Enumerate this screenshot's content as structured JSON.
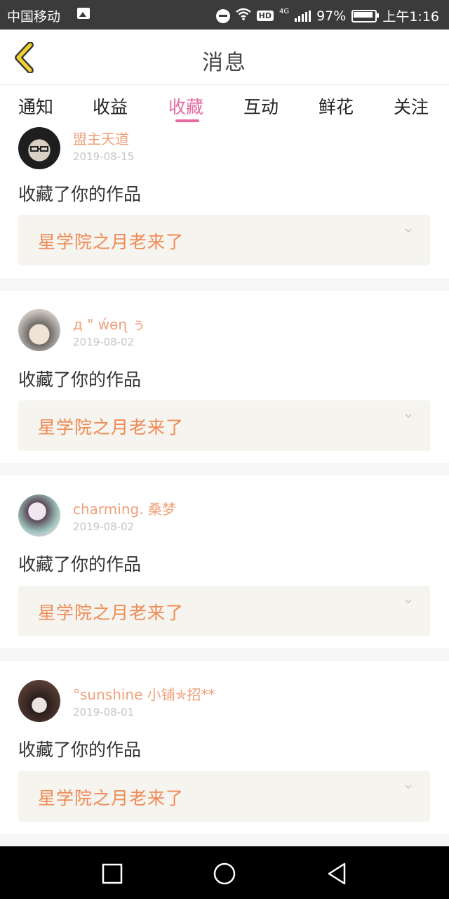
{
  "status_bar": {
    "carrier": "中国移动",
    "network_type": "4G",
    "hd_label": "HD",
    "battery": "97%",
    "time": "上午1:16",
    "icons": [
      "image-icon",
      "do-not-disturb-icon",
      "wifi-icon",
      "signal-icon",
      "battery-icon"
    ]
  },
  "header": {
    "title": "消息",
    "back_icon": "back-chevron-icon"
  },
  "tabs": [
    {
      "label": "通知",
      "active": false
    },
    {
      "label": "收益",
      "active": false
    },
    {
      "label": "收藏",
      "active": true
    },
    {
      "label": "互动",
      "active": false
    },
    {
      "label": "鲜花",
      "active": false
    },
    {
      "label": "关注",
      "active": false
    }
  ],
  "accent_color": "#e56ba1",
  "name_color": "#f0a07a",
  "work_title_color": "#f08a56",
  "notifications": [
    {
      "username": "盟主天道",
      "date": "2019-08-15",
      "action": "收藏了你的作品",
      "work_title": "星学院之月老来了"
    },
    {
      "username": "д \" ẃɵɳ ぅ",
      "date": "2019-08-02",
      "action": "收藏了你的作品",
      "work_title": "星学院之月老来了"
    },
    {
      "username": "charming. 桑梦",
      "date": "2019-08-02",
      "action": "收藏了你的作品",
      "work_title": "星学院之月老来了"
    },
    {
      "username": "°sunshine  小铺✯招**",
      "date": "2019-08-01",
      "action": "收藏了你的作品",
      "work_title": "星学院之月老来了"
    }
  ],
  "nav_bar": {
    "icons": [
      "recent-apps-icon",
      "home-icon",
      "back-icon"
    ]
  }
}
